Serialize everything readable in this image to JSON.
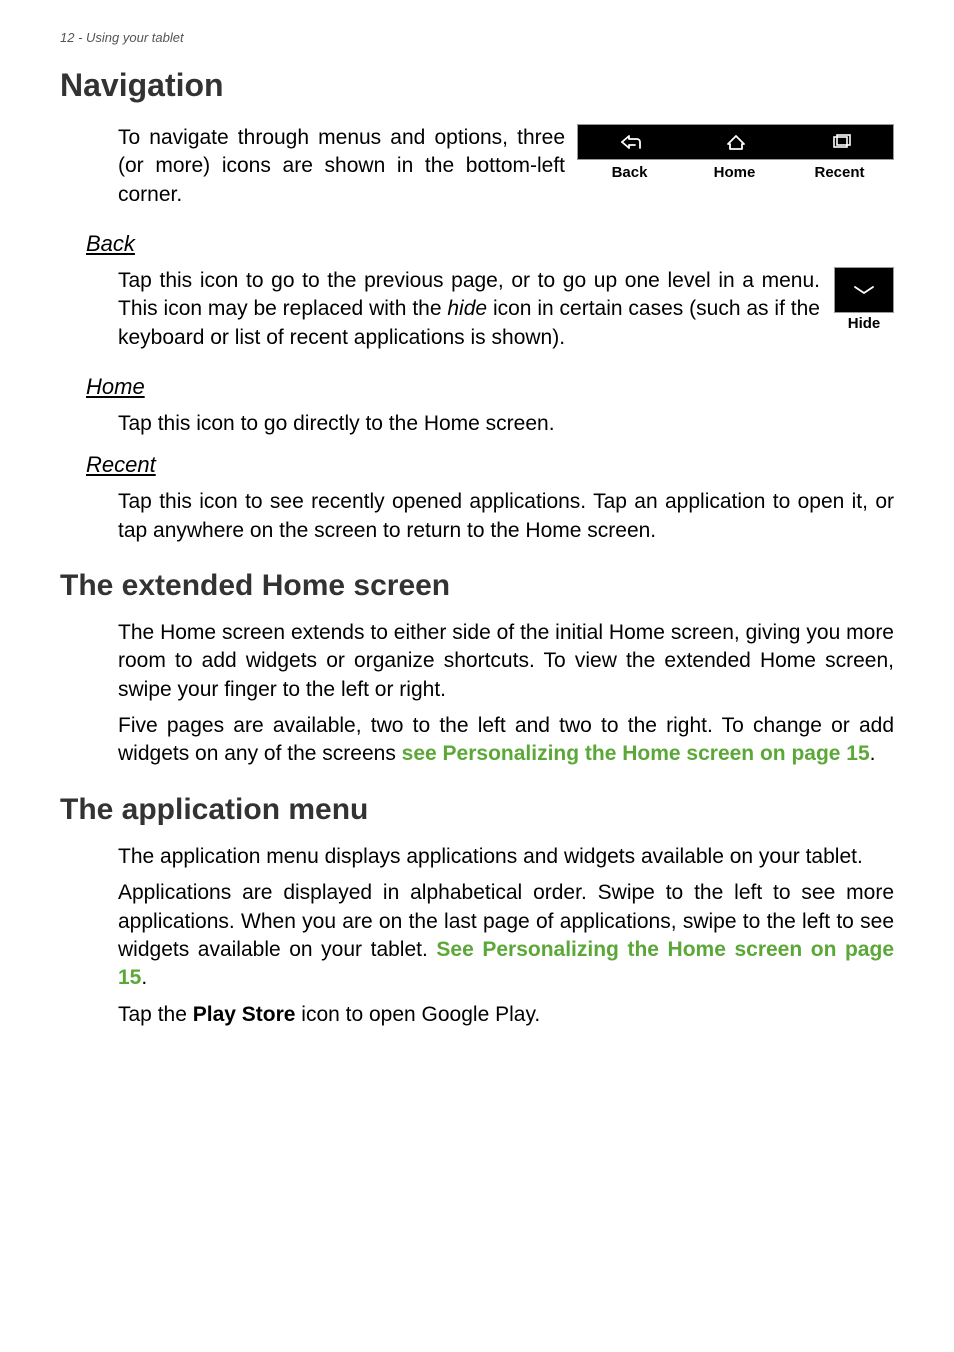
{
  "page_header": "12 - Using your tablet",
  "nav_section": {
    "title": "Navigation",
    "intro": "To navigate through menus and options, three (or more) icons are shown in the bottom-left corner.",
    "icons": {
      "back_label": "Back",
      "home_label": "Home",
      "recent_label": "Recent"
    },
    "back": {
      "title": "Back",
      "text_before": "Tap this icon to go to the previous page, or to go up one level in a menu. This icon may be replaced with the ",
      "hide_word": "hide",
      "text_after": " icon in certain cases (such as if the keyboard or list of recent applications is shown).",
      "hide_label": "Hide"
    },
    "home": {
      "title": "Home",
      "text": "Tap this icon to go directly to the Home screen."
    },
    "recent": {
      "title": "Recent",
      "text": "Tap this icon to see recently opened applications. Tap an application to open it, or tap anywhere on the screen to return to the Home screen."
    }
  },
  "ext_home": {
    "title": "The extended Home screen",
    "p1": "The Home screen extends to either side of the initial Home screen, giving you more room to add widgets or organize shortcuts. To view the extended Home screen, swipe your finger to the left or right.",
    "p2_before": "Five pages are available, two to the left and two to the right. To change or add widgets on any of the screens ",
    "p2_link": "see Personalizing the Home screen on page 15",
    "p2_after": "."
  },
  "app_menu": {
    "title": "The application menu",
    "p1": "The application menu displays applications and widgets available on your tablet.",
    "p2_before": "Applications are displayed in alphabetical order. Swipe to the left to see more applications. When you are on the last page of applications, swipe to the left to see widgets available on your tablet. ",
    "p2_link": "See Personalizing the Home screen on page 15",
    "p2_after": ".",
    "p3_before": "Tap the ",
    "p3_bold": "Play Store",
    "p3_after": " icon to open Google Play."
  }
}
